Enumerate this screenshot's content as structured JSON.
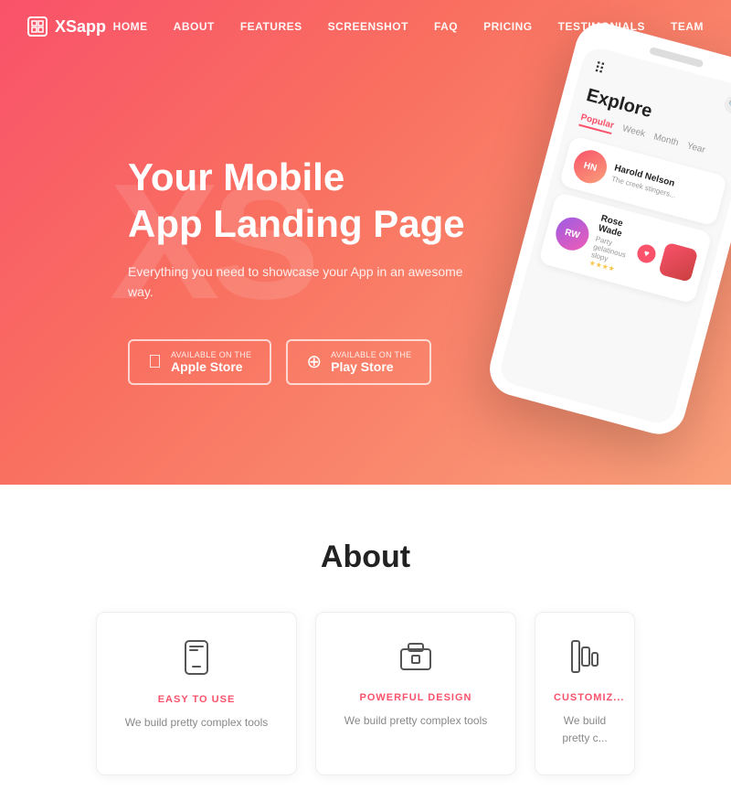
{
  "navbar": {
    "logo": "XSapp",
    "logo_icon": "◻",
    "links": [
      {
        "label": "HOME",
        "href": "#"
      },
      {
        "label": "ABOUT",
        "href": "#"
      },
      {
        "label": "FEATURES",
        "href": "#"
      },
      {
        "label": "SCREENSHOT",
        "href": "#"
      },
      {
        "label": "FAQ",
        "href": "#"
      },
      {
        "label": "PRICING",
        "href": "#"
      },
      {
        "label": "TESTIMONIALS",
        "href": "#"
      },
      {
        "label": "TEAM",
        "href": "#"
      }
    ]
  },
  "hero": {
    "bg_text": "XS",
    "title": "Your Mobile\nApp Landing Page",
    "subtitle": "Everything you need to showcase your App in an awesome way.",
    "btn_apple_small": "Available on the",
    "btn_apple_big": "Apple Store",
    "btn_play_small": "Available on the",
    "btn_play_big": "Play Store"
  },
  "phone": {
    "explore_label": "Explore",
    "tabs": [
      "Popular",
      "Week",
      "Month",
      "Year"
    ],
    "active_tab": "Popular",
    "card1_name": "Harold Nelson",
    "card1_desc": "The creek stingers...",
    "card2_name": "Rose Wade",
    "card2_desc": "Party gelatinous slopy",
    "card2_stars": "★★★★"
  },
  "about": {
    "title": "About",
    "cards": [
      {
        "icon": "📱",
        "title": "EASY TO USE",
        "desc": "We build pretty complex tools"
      },
      {
        "icon": "🏗",
        "title": "POWERFUL DESIGN",
        "desc": "We build pretty complex tools"
      },
      {
        "icon": "🔧",
        "title": "CUSTOMIZ...",
        "desc": "We build pretty c..."
      }
    ]
  }
}
